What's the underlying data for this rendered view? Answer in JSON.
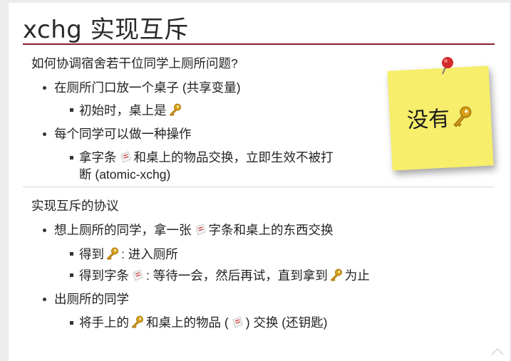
{
  "title": "xchg 实现互斥",
  "section1": {
    "heading": "如何协调宿舍若干位同学上厕所问题?",
    "b1": "在厕所门口放一个桌子 (共享变量)",
    "b1_sub_prefix": "初始时，桌上是",
    "b2": "每个同学可以做一种操作",
    "b2_sub_a": "拿字条",
    "b2_sub_b": "和桌上的物品交换，立即生效不被打",
    "b2_sub_c": "断 (atomic-xchg)"
  },
  "sticky": {
    "text": "没有"
  },
  "section2": {
    "heading": "实现互斥的协议",
    "b1_a": "想上厕所的同学，拿一张",
    "b1_b": "字条和桌上的东西交换",
    "s1": ": 进入厕所",
    "s1_prefix": "得到",
    "s2_prefix": "得到字条",
    "s2_mid": ": 等待一会，然后再试，直到拿到",
    "s2_end": "为止",
    "b2": "出厕所的同学",
    "s3_prefix": "将手上的",
    "s3_mid": "和桌上的物品 (",
    "s3_end": ") 交换 (还钥匙)"
  },
  "icons": {
    "key": "key-icon",
    "note": "paper-note-icon",
    "pin": "push-pin-icon"
  },
  "colors": {
    "title_rule": "#8b1f2a",
    "sticky": "#f7ee6b",
    "key": "#d9a21b",
    "pin": "#d42a2a"
  }
}
